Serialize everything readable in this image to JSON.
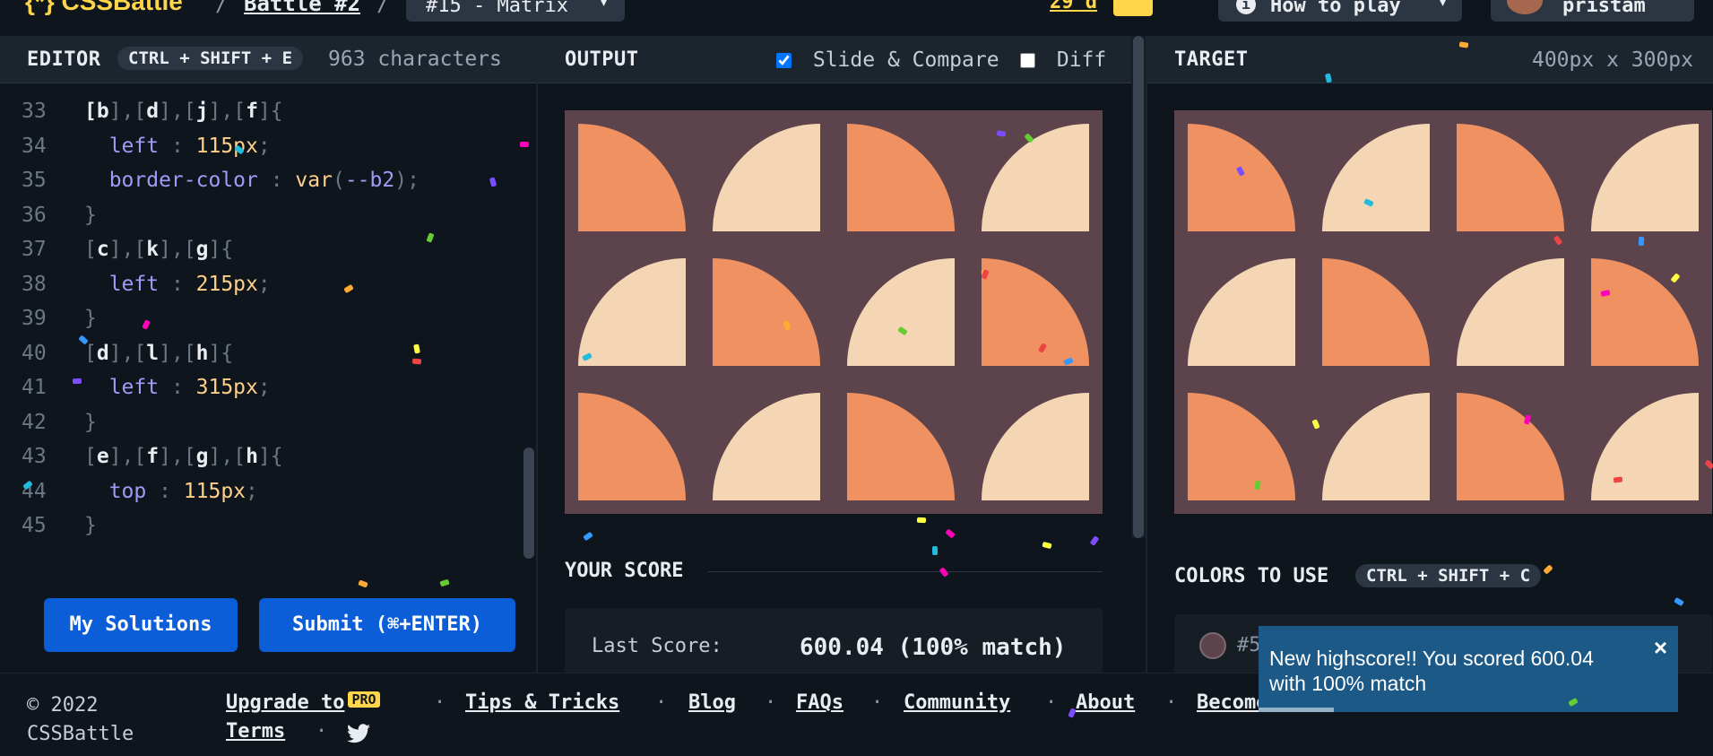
{
  "header": {
    "logo": "{*} CSSBattle",
    "breadcrumb": "Battle #2",
    "target_select": "#15 - Matrix",
    "streak": "29 d",
    "how_to_play": "How to play",
    "username": "pristam"
  },
  "editor": {
    "title": "EDITOR",
    "shortcut": "CTRL + SHIFT + E",
    "char_count": "963 characters",
    "lines": [
      {
        "num": "33",
        "parts": [
          [
            "sel",
            "["
          ],
          [
            "sel",
            "b"
          ],
          [
            "punc",
            "],["
          ],
          [
            "sel",
            "d"
          ],
          [
            "punc",
            "],["
          ],
          [
            "sel",
            "j"
          ],
          [
            "punc",
            "],["
          ],
          [
            "sel",
            "f"
          ],
          [
            "punc",
            "]{"
          ]
        ]
      },
      {
        "num": "34",
        "parts": [
          [
            "prop",
            "  left"
          ],
          [
            "punc",
            " : "
          ],
          [
            "val",
            "115px"
          ],
          [
            "punc",
            ";"
          ]
        ]
      },
      {
        "num": "35",
        "parts": [
          [
            "prop",
            "  border-color"
          ],
          [
            "punc",
            " : "
          ],
          [
            "val",
            "var"
          ],
          [
            "punc",
            "("
          ],
          [
            "prop",
            "--b2"
          ],
          [
            "punc",
            ");"
          ]
        ]
      },
      {
        "num": "36",
        "parts": [
          [
            "punc",
            "}"
          ]
        ]
      },
      {
        "num": "37",
        "parts": [
          [
            "punc",
            "["
          ],
          [
            "sel",
            "c"
          ],
          [
            "punc",
            "],["
          ],
          [
            "sel",
            "k"
          ],
          [
            "punc",
            "],["
          ],
          [
            "sel",
            "g"
          ],
          [
            "punc",
            "]{"
          ]
        ]
      },
      {
        "num": "38",
        "parts": [
          [
            "prop",
            "  left"
          ],
          [
            "punc",
            " : "
          ],
          [
            "val",
            "215px"
          ],
          [
            "punc",
            ";"
          ]
        ]
      },
      {
        "num": "39",
        "parts": [
          [
            "punc",
            "}"
          ]
        ]
      },
      {
        "num": "40",
        "parts": [
          [
            "punc",
            "["
          ],
          [
            "sel",
            "d"
          ],
          [
            "punc",
            "],["
          ],
          [
            "sel",
            "l"
          ],
          [
            "punc",
            "],["
          ],
          [
            "sel",
            "h"
          ],
          [
            "punc",
            "]{"
          ]
        ]
      },
      {
        "num": "41",
        "parts": [
          [
            "prop",
            "  left"
          ],
          [
            "punc",
            " : "
          ],
          [
            "val",
            "315px"
          ],
          [
            "punc",
            ";"
          ]
        ]
      },
      {
        "num": "42",
        "parts": [
          [
            "punc",
            "}"
          ]
        ]
      },
      {
        "num": "43",
        "parts": [
          [
            "punc",
            "["
          ],
          [
            "sel",
            "e"
          ],
          [
            "punc",
            "],["
          ],
          [
            "sel",
            "f"
          ],
          [
            "punc",
            "],["
          ],
          [
            "sel",
            "g"
          ],
          [
            "punc",
            "],["
          ],
          [
            "sel",
            "h"
          ],
          [
            "punc",
            "]{"
          ]
        ]
      },
      {
        "num": "44",
        "parts": [
          [
            "prop",
            "  top"
          ],
          [
            "punc",
            " : "
          ],
          [
            "val",
            "115px"
          ],
          [
            "punc",
            ";"
          ]
        ]
      },
      {
        "num": "45",
        "parts": [
          [
            "punc",
            "}"
          ]
        ]
      }
    ],
    "my_solutions": "My Solutions",
    "submit": "Submit (⌘+ENTER)"
  },
  "output": {
    "title": "OUTPUT",
    "slide_compare": "Slide & Compare",
    "slide_compare_checked": true,
    "diff": "Diff",
    "diff_checked": false
  },
  "target": {
    "title": "TARGET",
    "size": "400px x 300px"
  },
  "grid": [
    [
      "dark-tr",
      "light-tl",
      "dark-tr",
      "light-tl"
    ],
    [
      "light-tl",
      "dark-tr",
      "light-tl",
      "dark-tr"
    ],
    [
      "dark-tr",
      "light-tl",
      "dark-tr",
      "light-tl"
    ]
  ],
  "score": {
    "title": "YOUR SCORE",
    "last_label": "Last Score:",
    "last_value": "600.04 (100% match)"
  },
  "colors": {
    "title": "COLORS TO USE",
    "shortcut": "CTRL + SHIFT + C",
    "swatch_hex": "#5",
    "swatch_color": "#5c434c"
  },
  "toast": {
    "message": "New highscore!! You scored 600.04 with 100% match",
    "close": "×"
  },
  "footer": {
    "copyright": "© 2022 CSSBattle",
    "upgrade": "Upgrade to",
    "pro": "PRO",
    "tips": "Tips & Tricks",
    "blog": "Blog",
    "faqs": "FAQs",
    "community": "Community",
    "about": "About",
    "become": "Become",
    "terms": "Terms",
    "sep": "·"
  },
  "palette": {
    "bg": "#5c434c",
    "dark": "#ef9160",
    "light": "#f5d6b4",
    "accent": "#0b5ed7",
    "toast": "#1c5986"
  }
}
